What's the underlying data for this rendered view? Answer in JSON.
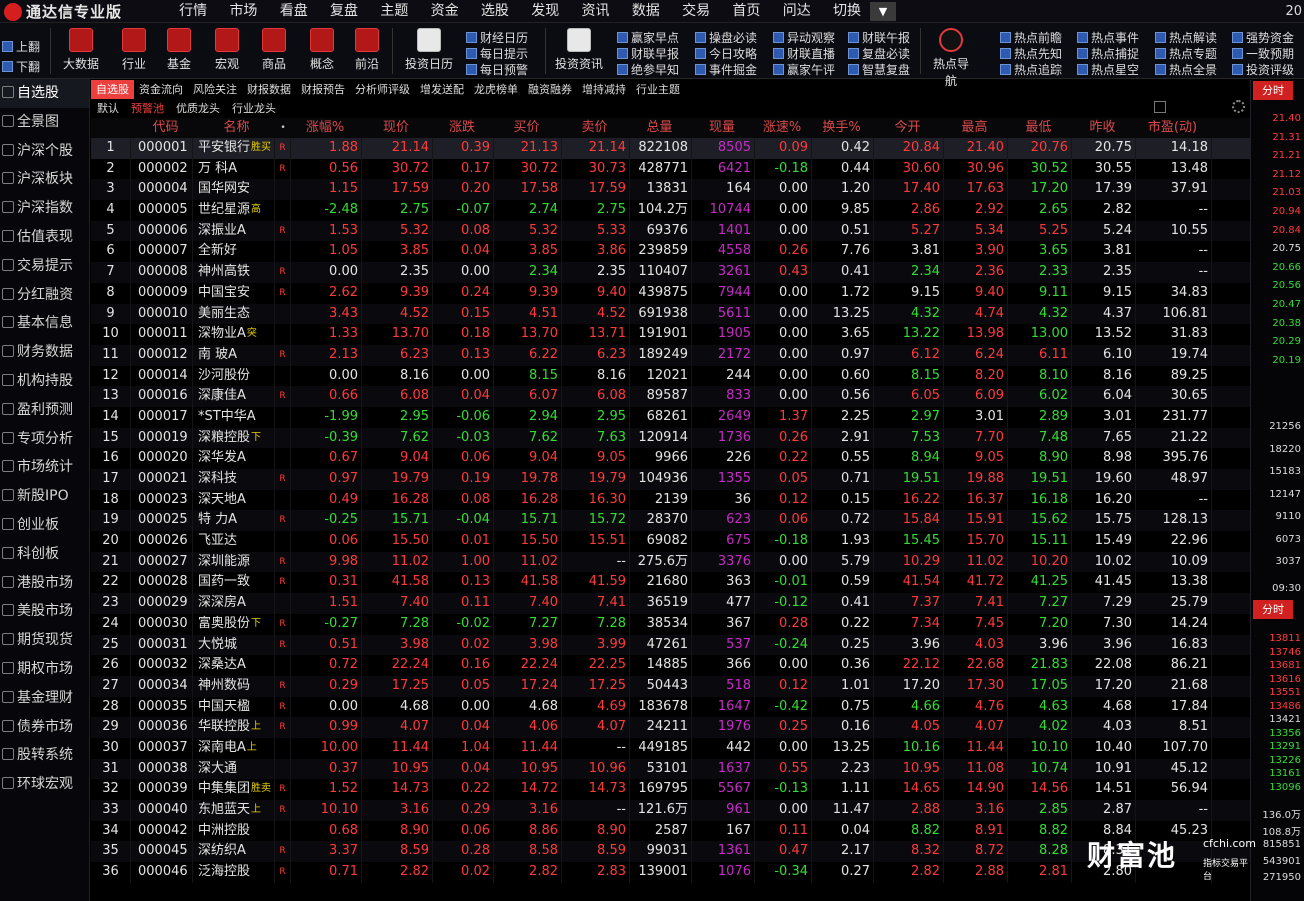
{
  "app": {
    "title": "通达信专业版",
    "corner": "20"
  },
  "menu": [
    "行情",
    "市场",
    "看盘",
    "复盘",
    "主题",
    "资金",
    "选股",
    "发现",
    "资讯",
    "数据",
    "交易",
    "首页",
    "问达",
    "切换"
  ],
  "toolbar": {
    "nav": [
      "上翻",
      "下翻"
    ],
    "big": [
      {
        "label": "大数据",
        "icon": "bigdata-icon"
      },
      {
        "label": "行业",
        "icon": "industry-icon"
      },
      {
        "label": "基金",
        "icon": "fund-icon"
      },
      {
        "label": "宏观",
        "icon": "macro-icon"
      },
      {
        "label": "商品",
        "icon": "commodity-icon"
      },
      {
        "label": "概念",
        "icon": "concept-icon"
      },
      {
        "label": "前沿",
        "icon": "frontier-icon"
      },
      {
        "label": "投资日历",
        "icon": "calendar-icon"
      },
      {
        "label": "投资资讯",
        "icon": "news-icon"
      },
      {
        "label": "热点导航",
        "icon": "target-icon"
      }
    ],
    "small": [
      "财经日历",
      "每日提示",
      "每日预警",
      "赢家早点",
      "财联早报",
      "绝参早知",
      "操盘必读",
      "今日攻略",
      "事件掘金",
      "异动观察",
      "财联直播",
      "赢家午评",
      "财联午报",
      "复盘必读",
      "智慧复盘",
      "热点前瞻",
      "热点先知",
      "热点追踪",
      "热点事件",
      "热点捕捉",
      "热点星空",
      "热点解读",
      "热点专题",
      "热点全景",
      "强势资金",
      "一致预期",
      "投资评级"
    ]
  },
  "sidebar": [
    "自选股",
    "全景图",
    "沪深个股",
    "沪深板块",
    "沪深指数",
    "估值表现",
    "交易提示",
    "分红融资",
    "基本信息",
    "财务数据",
    "机构持股",
    "盈利预测",
    "专项分析",
    "市场统计",
    "新股IPO",
    "创业板",
    "科创板",
    "港股市场",
    "美股市场",
    "期货现货",
    "期权市场",
    "基金理财",
    "债券市场",
    "股转系统",
    "环球宏观"
  ],
  "tabs1": [
    "自选股",
    "资金流向",
    "风险关注",
    "财报数据",
    "财报预告",
    "分析师评级",
    "增发送配",
    "龙虎榜单",
    "融资融券",
    "增持减持",
    "行业主题"
  ],
  "tabs2": [
    "默认",
    "预警池",
    "优质龙头",
    "行业龙头"
  ],
  "columns": [
    "",
    "代码",
    "名称",
    "•",
    "涨幅%",
    "现价",
    "涨跌",
    "买价",
    "卖价",
    "总量",
    "现量",
    "涨速%",
    "换手%",
    "今开",
    "最高",
    "最低",
    "昨收",
    "市盈(动)"
  ],
  "rows": [
    [
      "1",
      "000001",
      "平安银行",
      "R",
      "1.88",
      "21.14",
      "0.39",
      "21.13",
      "21.14",
      "822108",
      "8505",
      "0.09",
      "0.42",
      "20.84",
      "21.40",
      "20.76",
      "20.75",
      "14.18",
      "rrrrrrm r rrgg",
      "胜买"
    ],
    [
      "2",
      "000002",
      "万 科A",
      "R",
      "0.56",
      "30.72",
      "0.17",
      "30.72",
      "30.73",
      "428771",
      "6421",
      "-0.18",
      "0.44",
      "30.60",
      "30.96",
      "30.52",
      "30.55",
      "13.48",
      "",
      ""
    ],
    [
      "3",
      "000004",
      "国华网安",
      "",
      "1.15",
      "17.59",
      "0.20",
      "17.58",
      "17.59",
      "13831",
      "164",
      "0.00",
      "1.20",
      "17.40",
      "17.63",
      "17.20",
      "17.39",
      "37.91",
      "",
      ""
    ],
    [
      "4",
      "000005",
      "世纪星源",
      "",
      "-2.48",
      "2.75",
      "-0.07",
      "2.74",
      "2.75",
      "104.2万",
      "10744",
      "0.00",
      "9.85",
      "2.86",
      "2.92",
      "2.65",
      "2.82",
      "--",
      "",
      "高"
    ],
    [
      "5",
      "000006",
      "深振业A",
      "R",
      "1.53",
      "5.32",
      "0.08",
      "5.32",
      "5.33",
      "69376",
      "1401",
      "0.00",
      "0.51",
      "5.27",
      "5.34",
      "5.25",
      "5.24",
      "10.55",
      "",
      ""
    ],
    [
      "6",
      "000007",
      "全新好",
      "",
      "1.05",
      "3.85",
      "0.04",
      "3.85",
      "3.86",
      "239859",
      "4558",
      "0.26",
      "7.76",
      "3.81",
      "3.90",
      "3.65",
      "3.81",
      "--",
      "",
      ""
    ],
    [
      "7",
      "000008",
      "神州高铁",
      "R",
      "0.00",
      "2.35",
      "0.00",
      "2.34",
      "2.35",
      "110407",
      "3261",
      "0.43",
      "0.41",
      "2.34",
      "2.36",
      "2.33",
      "2.35",
      "--",
      "",
      ""
    ],
    [
      "8",
      "000009",
      "中国宝安",
      "R",
      "2.62",
      "9.39",
      "0.24",
      "9.39",
      "9.40",
      "439875",
      "7944",
      "0.00",
      "1.72",
      "9.15",
      "9.40",
      "9.11",
      "9.15",
      "34.83",
      "",
      ""
    ],
    [
      "9",
      "000010",
      "美丽生态",
      "",
      "3.43",
      "4.52",
      "0.15",
      "4.51",
      "4.52",
      "691938",
      "5611",
      "0.00",
      "13.25",
      "4.32",
      "4.74",
      "4.32",
      "4.37",
      "106.81",
      "",
      ""
    ],
    [
      "10",
      "000011",
      "深物业A",
      "",
      "1.33",
      "13.70",
      "0.18",
      "13.70",
      "13.71",
      "191901",
      "1905",
      "0.00",
      "3.65",
      "13.22",
      "13.98",
      "13.00",
      "13.52",
      "31.83",
      "",
      "突"
    ],
    [
      "11",
      "000012",
      "南 玻A",
      "R",
      "2.13",
      "6.23",
      "0.13",
      "6.22",
      "6.23",
      "189249",
      "2172",
      "0.00",
      "0.97",
      "6.12",
      "6.24",
      "6.11",
      "6.10",
      "19.74",
      "",
      ""
    ],
    [
      "12",
      "000014",
      "沙河股份",
      "",
      "0.00",
      "8.16",
      "0.00",
      "8.15",
      "8.16",
      "12021",
      "244",
      "0.00",
      "0.60",
      "8.15",
      "8.20",
      "8.10",
      "8.16",
      "89.25",
      "",
      ""
    ],
    [
      "13",
      "000016",
      "深康佳A",
      "R",
      "0.66",
      "6.08",
      "0.04",
      "6.07",
      "6.08",
      "89587",
      "833",
      "0.00",
      "0.56",
      "6.05",
      "6.09",
      "6.02",
      "6.04",
      "30.65",
      "",
      ""
    ],
    [
      "14",
      "000017",
      "*ST中华A",
      "",
      "-1.99",
      "2.95",
      "-0.06",
      "2.94",
      "2.95",
      "68261",
      "2649",
      "1.37",
      "2.25",
      "2.97",
      "3.01",
      "2.89",
      "3.01",
      "231.77",
      "",
      ""
    ],
    [
      "15",
      "000019",
      "深粮控股",
      "",
      "-0.39",
      "7.62",
      "-0.03",
      "7.62",
      "7.63",
      "120914",
      "1736",
      "0.26",
      "2.91",
      "7.53",
      "7.70",
      "7.48",
      "7.65",
      "21.22",
      "",
      "下"
    ],
    [
      "16",
      "000020",
      "深华发A",
      "",
      "0.67",
      "9.04",
      "0.06",
      "9.04",
      "9.05",
      "9966",
      "226",
      "0.22",
      "0.55",
      "8.94",
      "9.05",
      "8.90",
      "8.98",
      "395.76",
      "",
      ""
    ],
    [
      "17",
      "000021",
      "深科技",
      "R",
      "0.97",
      "19.79",
      "0.19",
      "19.78",
      "19.79",
      "104936",
      "1355",
      "0.05",
      "0.71",
      "19.51",
      "19.88",
      "19.51",
      "19.60",
      "48.97",
      "",
      ""
    ],
    [
      "18",
      "000023",
      "深天地A",
      "",
      "0.49",
      "16.28",
      "0.08",
      "16.28",
      "16.30",
      "2139",
      "36",
      "0.12",
      "0.15",
      "16.22",
      "16.37",
      "16.18",
      "16.20",
      "--",
      "",
      ""
    ],
    [
      "19",
      "000025",
      "特 力A",
      "R",
      "-0.25",
      "15.71",
      "-0.04",
      "15.71",
      "15.72",
      "28370",
      "623",
      "0.06",
      "0.72",
      "15.84",
      "15.91",
      "15.62",
      "15.75",
      "128.13",
      "",
      ""
    ],
    [
      "20",
      "000026",
      "飞亚达",
      "",
      "0.06",
      "15.50",
      "0.01",
      "15.50",
      "15.51",
      "69082",
      "675",
      "-0.18",
      "1.93",
      "15.45",
      "15.70",
      "15.11",
      "15.49",
      "22.96",
      "",
      ""
    ],
    [
      "21",
      "000027",
      "深圳能源",
      "R",
      "9.98",
      "11.02",
      "1.00",
      "11.02",
      "--",
      "275.6万",
      "3376",
      "0.00",
      "5.79",
      "10.29",
      "11.02",
      "10.20",
      "10.02",
      "10.09",
      "",
      ""
    ],
    [
      "22",
      "000028",
      "国药一致",
      "R",
      "0.31",
      "41.58",
      "0.13",
      "41.58",
      "41.59",
      "21680",
      "363",
      "-0.01",
      "0.59",
      "41.54",
      "41.72",
      "41.25",
      "41.45",
      "13.38",
      "",
      ""
    ],
    [
      "23",
      "000029",
      "深深房A",
      "",
      "1.51",
      "7.40",
      "0.11",
      "7.40",
      "7.41",
      "36519",
      "477",
      "-0.12",
      "0.41",
      "7.37",
      "7.41",
      "7.27",
      "7.29",
      "25.79",
      "",
      ""
    ],
    [
      "24",
      "000030",
      "富奥股份",
      "R",
      "-0.27",
      "7.28",
      "-0.02",
      "7.27",
      "7.28",
      "38534",
      "367",
      "0.28",
      "0.22",
      "7.34",
      "7.45",
      "7.20",
      "7.30",
      "14.24",
      "",
      "下"
    ],
    [
      "25",
      "000031",
      "大悦城",
      "R",
      "0.51",
      "3.98",
      "0.02",
      "3.98",
      "3.99",
      "47261",
      "537",
      "-0.24",
      "0.25",
      "3.96",
      "4.03",
      "3.96",
      "3.96",
      "16.83",
      "",
      ""
    ],
    [
      "26",
      "000032",
      "深桑达A",
      "",
      "0.72",
      "22.24",
      "0.16",
      "22.24",
      "22.25",
      "14885",
      "366",
      "0.00",
      "0.36",
      "22.12",
      "22.68",
      "21.83",
      "22.08",
      "86.21",
      "",
      ""
    ],
    [
      "27",
      "000034",
      "神州数码",
      "R",
      "0.29",
      "17.25",
      "0.05",
      "17.24",
      "17.25",
      "50443",
      "518",
      "0.12",
      "1.01",
      "17.20",
      "17.30",
      "17.05",
      "17.20",
      "21.68",
      "",
      ""
    ],
    [
      "28",
      "000035",
      "中国天楹",
      "R",
      "0.00",
      "4.68",
      "0.00",
      "4.68",
      "4.69",
      "183678",
      "1647",
      "-0.42",
      "0.75",
      "4.66",
      "4.76",
      "4.63",
      "4.68",
      "17.84",
      "",
      ""
    ],
    [
      "29",
      "000036",
      "华联控股",
      "R",
      "0.99",
      "4.07",
      "0.04",
      "4.06",
      "4.07",
      "24211",
      "1976",
      "0.25",
      "0.16",
      "4.05",
      "4.07",
      "4.02",
      "4.03",
      "8.51",
      "",
      "上"
    ],
    [
      "30",
      "000037",
      "深南电A",
      "",
      "10.00",
      "11.44",
      "1.04",
      "11.44",
      "--",
      "449185",
      "442",
      "0.00",
      "13.25",
      "10.16",
      "11.44",
      "10.10",
      "10.40",
      "107.70",
      "",
      "上"
    ],
    [
      "31",
      "000038",
      "深大通",
      "",
      "0.37",
      "10.95",
      "0.04",
      "10.95",
      "10.96",
      "53101",
      "1637",
      "0.55",
      "2.23",
      "10.95",
      "11.08",
      "10.74",
      "10.91",
      "45.12",
      "",
      ""
    ],
    [
      "32",
      "000039",
      "中集集团",
      "R",
      "1.52",
      "14.73",
      "0.22",
      "14.72",
      "14.73",
      "169795",
      "5567",
      "-0.13",
      "1.11",
      "14.65",
      "14.90",
      "14.56",
      "14.51",
      "56.94",
      "",
      "胜卖"
    ],
    [
      "33",
      "000040",
      "东旭蓝天",
      "R",
      "10.10",
      "3.16",
      "0.29",
      "3.16",
      "--",
      "121.6万",
      "961",
      "0.00",
      "11.47",
      "2.88",
      "3.16",
      "2.85",
      "2.87",
      "--",
      "",
      "上"
    ],
    [
      "34",
      "000042",
      "中洲控股",
      "",
      "0.68",
      "8.90",
      "0.06",
      "8.86",
      "8.90",
      "2587",
      "167",
      "0.11",
      "0.04",
      "8.82",
      "8.91",
      "8.82",
      "8.84",
      "45.23",
      "",
      ""
    ],
    [
      "35",
      "000045",
      "深纺织A",
      "R",
      "3.37",
      "8.59",
      "0.28",
      "8.58",
      "8.59",
      "99031",
      "1361",
      "0.47",
      "2.17",
      "8.32",
      "8.72",
      "8.28",
      "8.31",
      "",
      "",
      ""
    ],
    [
      "36",
      "000046",
      "泛海控股",
      "R",
      "0.71",
      "2.82",
      "0.02",
      "2.82",
      "2.83",
      "139001",
      "1076",
      "-0.34",
      "0.27",
      "2.82",
      "2.88",
      "2.81",
      "2.80",
      "",
      "",
      ""
    ]
  ],
  "right_panel": {
    "button1": "分时",
    "prices": [
      "21.40",
      "21.31",
      "21.21",
      "21.12",
      "21.03",
      "20.94",
      "20.84",
      "20.75",
      "20.66",
      "20.56",
      "20.47",
      "20.38",
      "20.29",
      "20.19"
    ],
    "volumes": [
      "21256",
      "18220",
      "15183",
      "12147",
      "9110",
      "6073",
      "3037"
    ],
    "time": "09:30",
    "button2": "分时",
    "prices2": [
      "13811",
      "13746",
      "13681",
      "13616",
      "13551",
      "13486",
      "13421",
      "13356",
      "13291",
      "13226",
      "13161",
      "13096"
    ],
    "vols2": [
      "136.0万",
      "108.8万",
      "815851",
      "543901",
      "271950"
    ]
  },
  "watermark": {
    "big": "财富池",
    "domain": "cfchi.com",
    "sub": "指标交易平台"
  }
}
